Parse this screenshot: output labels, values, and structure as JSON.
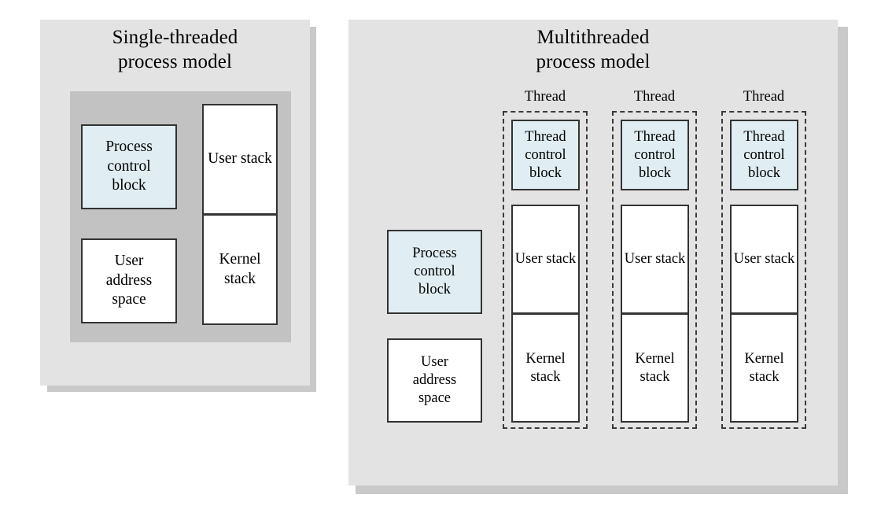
{
  "figure": {
    "kind": "process-thread-model-diagram",
    "background": "#ffffff",
    "panel_color": "#e3e3e3",
    "panel_shadow_color": "#c9c9c9",
    "inner_panel_color": "#c2c2c2",
    "highlight_color": "#e0eef3",
    "border_color": "#333333"
  },
  "left_panel": {
    "title_line1": "Single-threaded",
    "title_line2": "process model",
    "process_control_block": "Process\ncontrol\nblock",
    "pcb_line1": "Process",
    "pcb_line2": "control",
    "pcb_line3": "block",
    "uas_line1": "User",
    "uas_line2": "address",
    "uas_line3": "space",
    "user_stack_line1": "User",
    "user_stack_line2": "stack",
    "kernel_stack_line1": "Kernel",
    "kernel_stack_line2": "stack"
  },
  "right_panel": {
    "title_line1": "Multithreaded",
    "title_line2": "process model",
    "pcb_line1": "Process",
    "pcb_line2": "control",
    "pcb_line3": "block",
    "uas_line1": "User",
    "uas_line2": "address",
    "uas_line3": "space",
    "threads": [
      {
        "label": "Thread",
        "tcb_line1": "Thread",
        "tcb_line2": "control",
        "tcb_line3": "block",
        "user_stack_line1": "User",
        "user_stack_line2": "stack",
        "kernel_stack_line1": "Kernel",
        "kernel_stack_line2": "stack"
      },
      {
        "label": "Thread",
        "tcb_line1": "Thread",
        "tcb_line2": "control",
        "tcb_line3": "block",
        "user_stack_line1": "User",
        "user_stack_line2": "stack",
        "kernel_stack_line1": "Kernel",
        "kernel_stack_line2": "stack"
      },
      {
        "label": "Thread",
        "tcb_line1": "Thread",
        "tcb_line2": "control",
        "tcb_line3": "block",
        "user_stack_line1": "User",
        "user_stack_line2": "stack",
        "kernel_stack_line1": "Kernel",
        "kernel_stack_line2": "stack"
      }
    ]
  }
}
